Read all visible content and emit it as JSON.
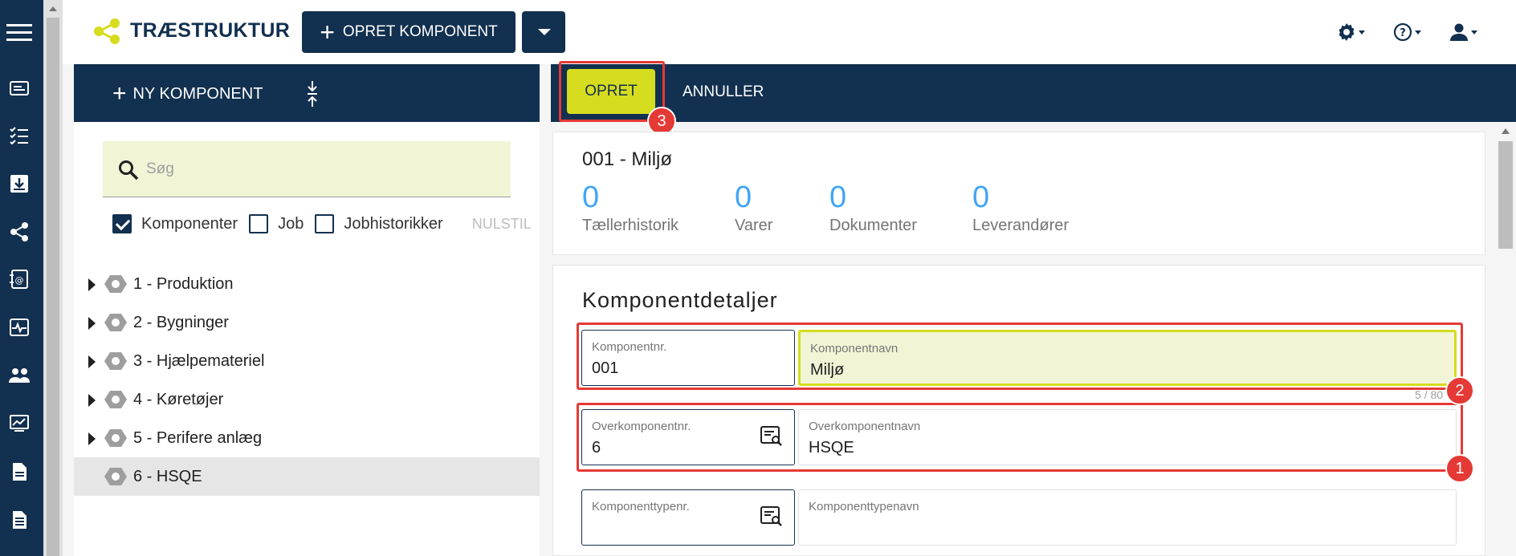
{
  "app": {
    "title": "TRÆSTRUKTUR",
    "create_button": "OPRET KOMPONENT"
  },
  "colors": {
    "navy": "#12304f",
    "accent": "#d6dc1e",
    "highlight": "#e53935",
    "stat_blue": "#42a5f5"
  },
  "rail": {
    "icons": [
      "menu-icon",
      "card-icon",
      "checklist-icon",
      "download-box-icon",
      "share-tree-icon",
      "contact-book-icon",
      "pulse-monitor-icon",
      "people-icon",
      "chart-monitor-icon",
      "document-icon",
      "document-lines-icon"
    ]
  },
  "top_icons": [
    "gear-icon",
    "help-icon",
    "user-icon"
  ],
  "left_panel": {
    "new_component": "NY KOMPONENT",
    "search_placeholder": "Søg",
    "filters": [
      {
        "label": "Komponenter",
        "checked": true
      },
      {
        "label": "Job",
        "checked": false
      },
      {
        "label": "Jobhistorikker",
        "checked": false
      }
    ],
    "reset": "NULSTIL",
    "tree": [
      {
        "label": "1 - Produktion",
        "expandable": true,
        "selected": false
      },
      {
        "label": "2 - Bygninger",
        "expandable": true,
        "selected": false
      },
      {
        "label": "3 - Hjælpemateriel",
        "expandable": true,
        "selected": false
      },
      {
        "label": "4 - Køretøjer",
        "expandable": true,
        "selected": false
      },
      {
        "label": "5 - Perifere anlæg",
        "expandable": true,
        "selected": false
      },
      {
        "label": "6 - HSQE",
        "expandable": false,
        "selected": true
      }
    ]
  },
  "toolbar": {
    "create": "OPRET",
    "cancel": "ANNULLER"
  },
  "summary": {
    "title": "001 - Miljø",
    "stats": [
      {
        "value": "0",
        "label": "Tællerhistorik"
      },
      {
        "value": "0",
        "label": "Varer"
      },
      {
        "value": "0",
        "label": "Dokumenter"
      },
      {
        "value": "0",
        "label": "Leverandører"
      }
    ]
  },
  "details": {
    "title": "Komponentdetaljer",
    "component_no": {
      "label": "Komponentnr.",
      "value": "001"
    },
    "component_name": {
      "label": "Komponentnavn",
      "value": "Miljø",
      "counter": "5 / 80"
    },
    "parent_no": {
      "label": "Overkomponentnr.",
      "value": "6"
    },
    "parent_name": {
      "label": "Overkomponentnavn",
      "value": "HSQE"
    },
    "type_no": {
      "label": "Komponenttypenr.",
      "value": ""
    },
    "type_name": {
      "label": "Komponenttypenavn",
      "value": ""
    }
  },
  "badges": [
    "1",
    "2",
    "3"
  ]
}
